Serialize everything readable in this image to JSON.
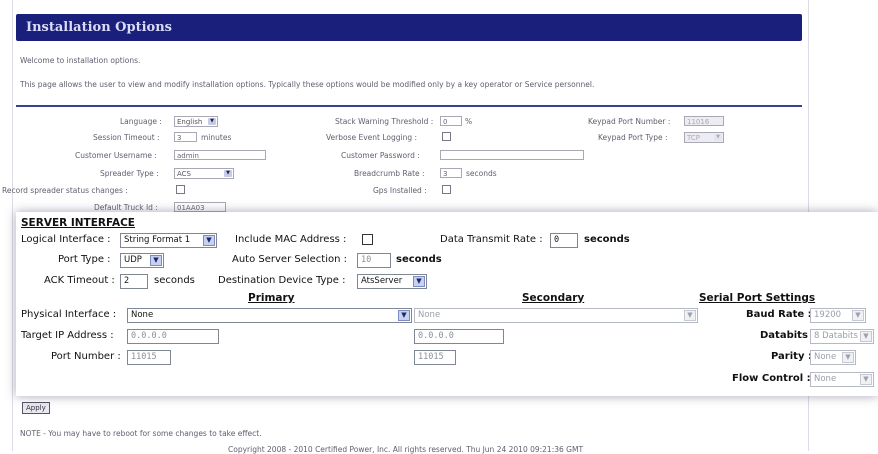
{
  "header": {
    "title": "Installation Options"
  },
  "intro": {
    "welcome": "Welcome to installation options.",
    "description": "This page allows the user to view and modify installation options. Typically these options would be modified only by a key operator or Service personnel."
  },
  "general": {
    "language_label": "Language :",
    "language_value": "English",
    "session_timeout_label": "Session Timeout :",
    "session_timeout_value": "3",
    "session_timeout_unit": "minutes",
    "customer_username_label": "Customer Username :",
    "customer_username_value": "admin",
    "spreader_type_label": "Spreader Type :",
    "spreader_type_value": "ACS",
    "record_spreader_label": "Record spreader status changes :",
    "default_truck_label": "Default Truck Id :",
    "default_truck_value": "01AA03",
    "stack_warning_label": "Stack Warning Threshold :",
    "stack_warning_value": "0",
    "stack_warning_unit": "%",
    "verbose_label": "Verbose Event Logging :",
    "customer_password_label": "Customer Password :",
    "breadcrumb_label": "Breadcrumb Rate :",
    "breadcrumb_value": "3",
    "breadcrumb_unit": "seconds",
    "gps_label": "Gps Installed :",
    "keypad_port_number_label": "Keypad Port Number :",
    "keypad_port_number_value": "11016",
    "keypad_port_type_label": "Keypad Port Type :",
    "keypad_port_type_value": "TCP"
  },
  "server_interface": {
    "heading": "SERVER INTERFACE",
    "logical_interface_label": "Logical Interface :",
    "logical_interface_value": "String Format 1",
    "include_mac_label": "Include MAC Address :",
    "data_transmit_label": "Data Transmit Rate :",
    "data_transmit_value": "0",
    "data_transmit_unit": "seconds",
    "port_type_label": "Port Type :",
    "port_type_value": "UDP",
    "auto_server_label": "Auto Server Selection :",
    "auto_server_value": "10",
    "auto_server_unit": "seconds",
    "ack_timeout_label": "ACK Timeout :",
    "ack_timeout_value": "2",
    "ack_timeout_unit": "seconds",
    "destination_label": "Destination Device Type :",
    "destination_value": "AtsServer",
    "primary_heading": "Primary",
    "secondary_heading": "Secondary",
    "serial_heading": "Serial Port Settings",
    "physical_interface_label": "Physical Interface :",
    "physical_primary_value": "None",
    "physical_secondary_value": "None",
    "target_ip_label": "Target IP Address :",
    "target_ip_primary": "0.0.0.0",
    "target_ip_secondary": "0.0.0.0",
    "port_number_label": "Port Number :",
    "port_number_primary": "11015",
    "port_number_secondary": "11015",
    "baud_rate_label": "Baud Rate :",
    "baud_rate_value": "19200",
    "databits_label": "Databits :",
    "databits_value": "8 Databits",
    "parity_label": "Parity :",
    "parity_value": "None",
    "flow_control_label": "Flow Control :",
    "flow_control_value": "None"
  },
  "footer": {
    "apply_label": "Apply",
    "note": "NOTE - You may have to reboot for some changes to take effect.",
    "copyright": "Copyright 2008 - 2010 Certified Power, Inc. All rights reserved. Thu Jun 24 2010 09:21:36 GMT"
  },
  "colors": {
    "title_bar": "#1a1f7c",
    "rule": "#3a3f96",
    "dropdown_accent": "#c8d1ef"
  }
}
